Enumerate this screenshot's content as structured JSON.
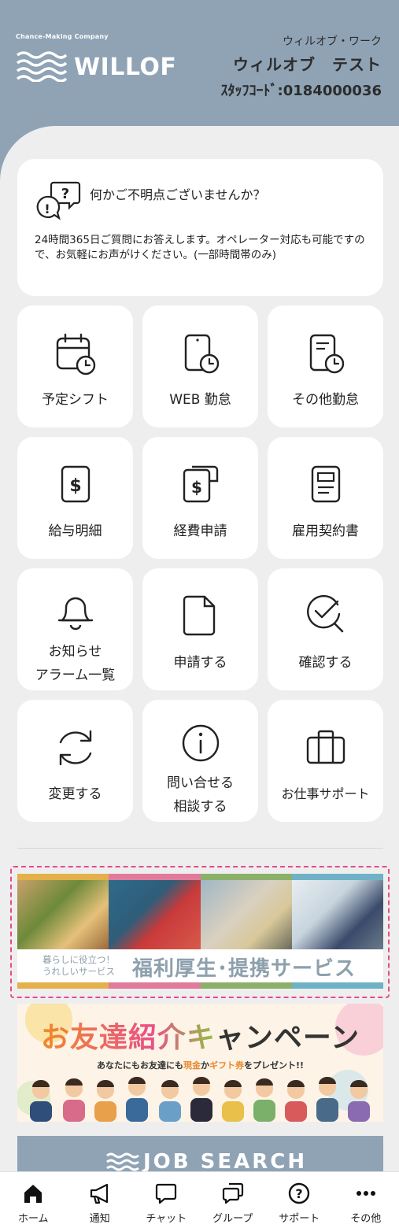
{
  "header": {
    "tagline": "Chance-Making Company",
    "brand": "WILLOF",
    "company": "ウィルオブ・ワーク",
    "user_name": "ウィルオブ　テスト",
    "staff_code": "ｽﾀｯﾌｺｰﾄﾞ:0184000036"
  },
  "help": {
    "icon": "question-chat-icon",
    "title": "何かご不明点ございませんか？",
    "body": "24時間365日ご質問にお答えします。オペレーター対応も可能ですので、お気軽にお声がけください。(一部時間帯のみ)"
  },
  "menu": [
    {
      "label": "予定シフト",
      "icon": "calendar-clock-icon"
    },
    {
      "label": "WEB 勤怠",
      "icon": "phone-clock-icon"
    },
    {
      "label": "その他勤怠",
      "icon": "document-clock-icon"
    },
    {
      "label": "給与明細",
      "icon": "payslip-icon"
    },
    {
      "label": "経費申請",
      "icon": "expense-icon"
    },
    {
      "label": "雇用契約書",
      "icon": "contract-icon"
    },
    {
      "label": "お知らせ",
      "label2": "アラーム一覧",
      "icon": "bell-icon"
    },
    {
      "label": "申請する",
      "icon": "file-icon"
    },
    {
      "label": "確認する",
      "icon": "check-search-icon"
    },
    {
      "label": "変更する",
      "icon": "refresh-icon"
    },
    {
      "label": "問い合せる",
      "label2": "相談する",
      "icon": "info-icon"
    },
    {
      "label": "お仕事サポート",
      "icon": "briefcase-icon"
    }
  ],
  "banners": {
    "welfare_sub1": "暮らしに役立つ！",
    "welfare_sub2": "うれしいサービス",
    "welfare_main": "福利厚生･提携サービス",
    "referral_title": "お友達紹介キャンペーン",
    "referral_sub_a": "あなたにもお友達にも",
    "referral_sub_b": "現金",
    "referral_sub_c": "か",
    "referral_sub_d": "ギフト券",
    "referral_sub_e": "をプレゼント!!",
    "job_search": "JOB SEARCH"
  },
  "nav": [
    {
      "label": "ホーム",
      "icon": "home-icon"
    },
    {
      "label": "通知",
      "icon": "megaphone-icon"
    },
    {
      "label": "チャット",
      "icon": "chat-icon"
    },
    {
      "label": "グループ",
      "icon": "group-chat-icon"
    },
    {
      "label": "サポート",
      "icon": "help-circle-icon"
    },
    {
      "label": "その他",
      "icon": "more-icon"
    }
  ],
  "colors": {
    "header": "#8fa3b5",
    "background": "#eeeeef",
    "accent_pink": "#e84a8a"
  }
}
